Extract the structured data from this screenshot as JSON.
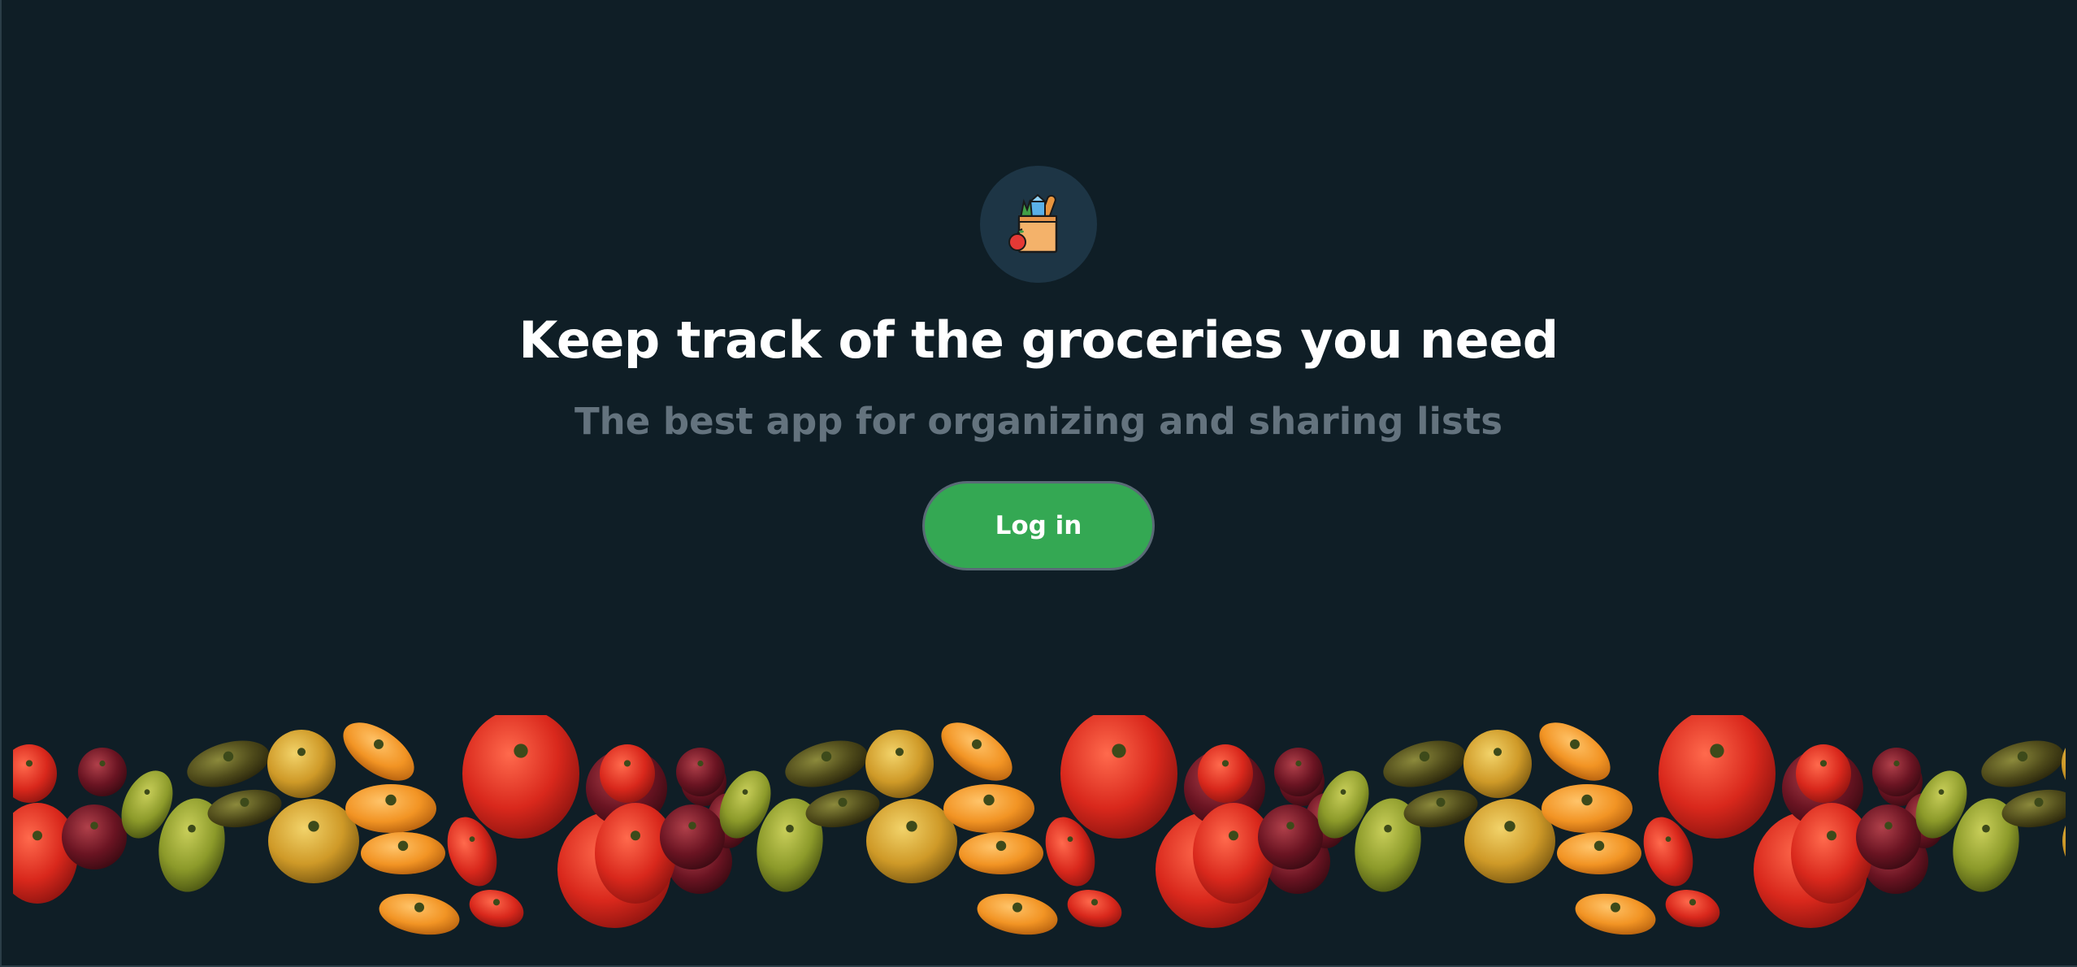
{
  "hero": {
    "logo_icon": "grocery-bag-icon",
    "headline": "Keep track of the groceries you need",
    "subheadline": "The best app for organizing and sharing lists",
    "login_label": "Log in"
  },
  "footer": {
    "decoration": "tomato-produce-banner"
  },
  "colors": {
    "background": "#0f1e26",
    "logo_circle": "#1d3545",
    "headline": "#ffffff",
    "subheadline": "#64737e",
    "button": "#34a853"
  }
}
